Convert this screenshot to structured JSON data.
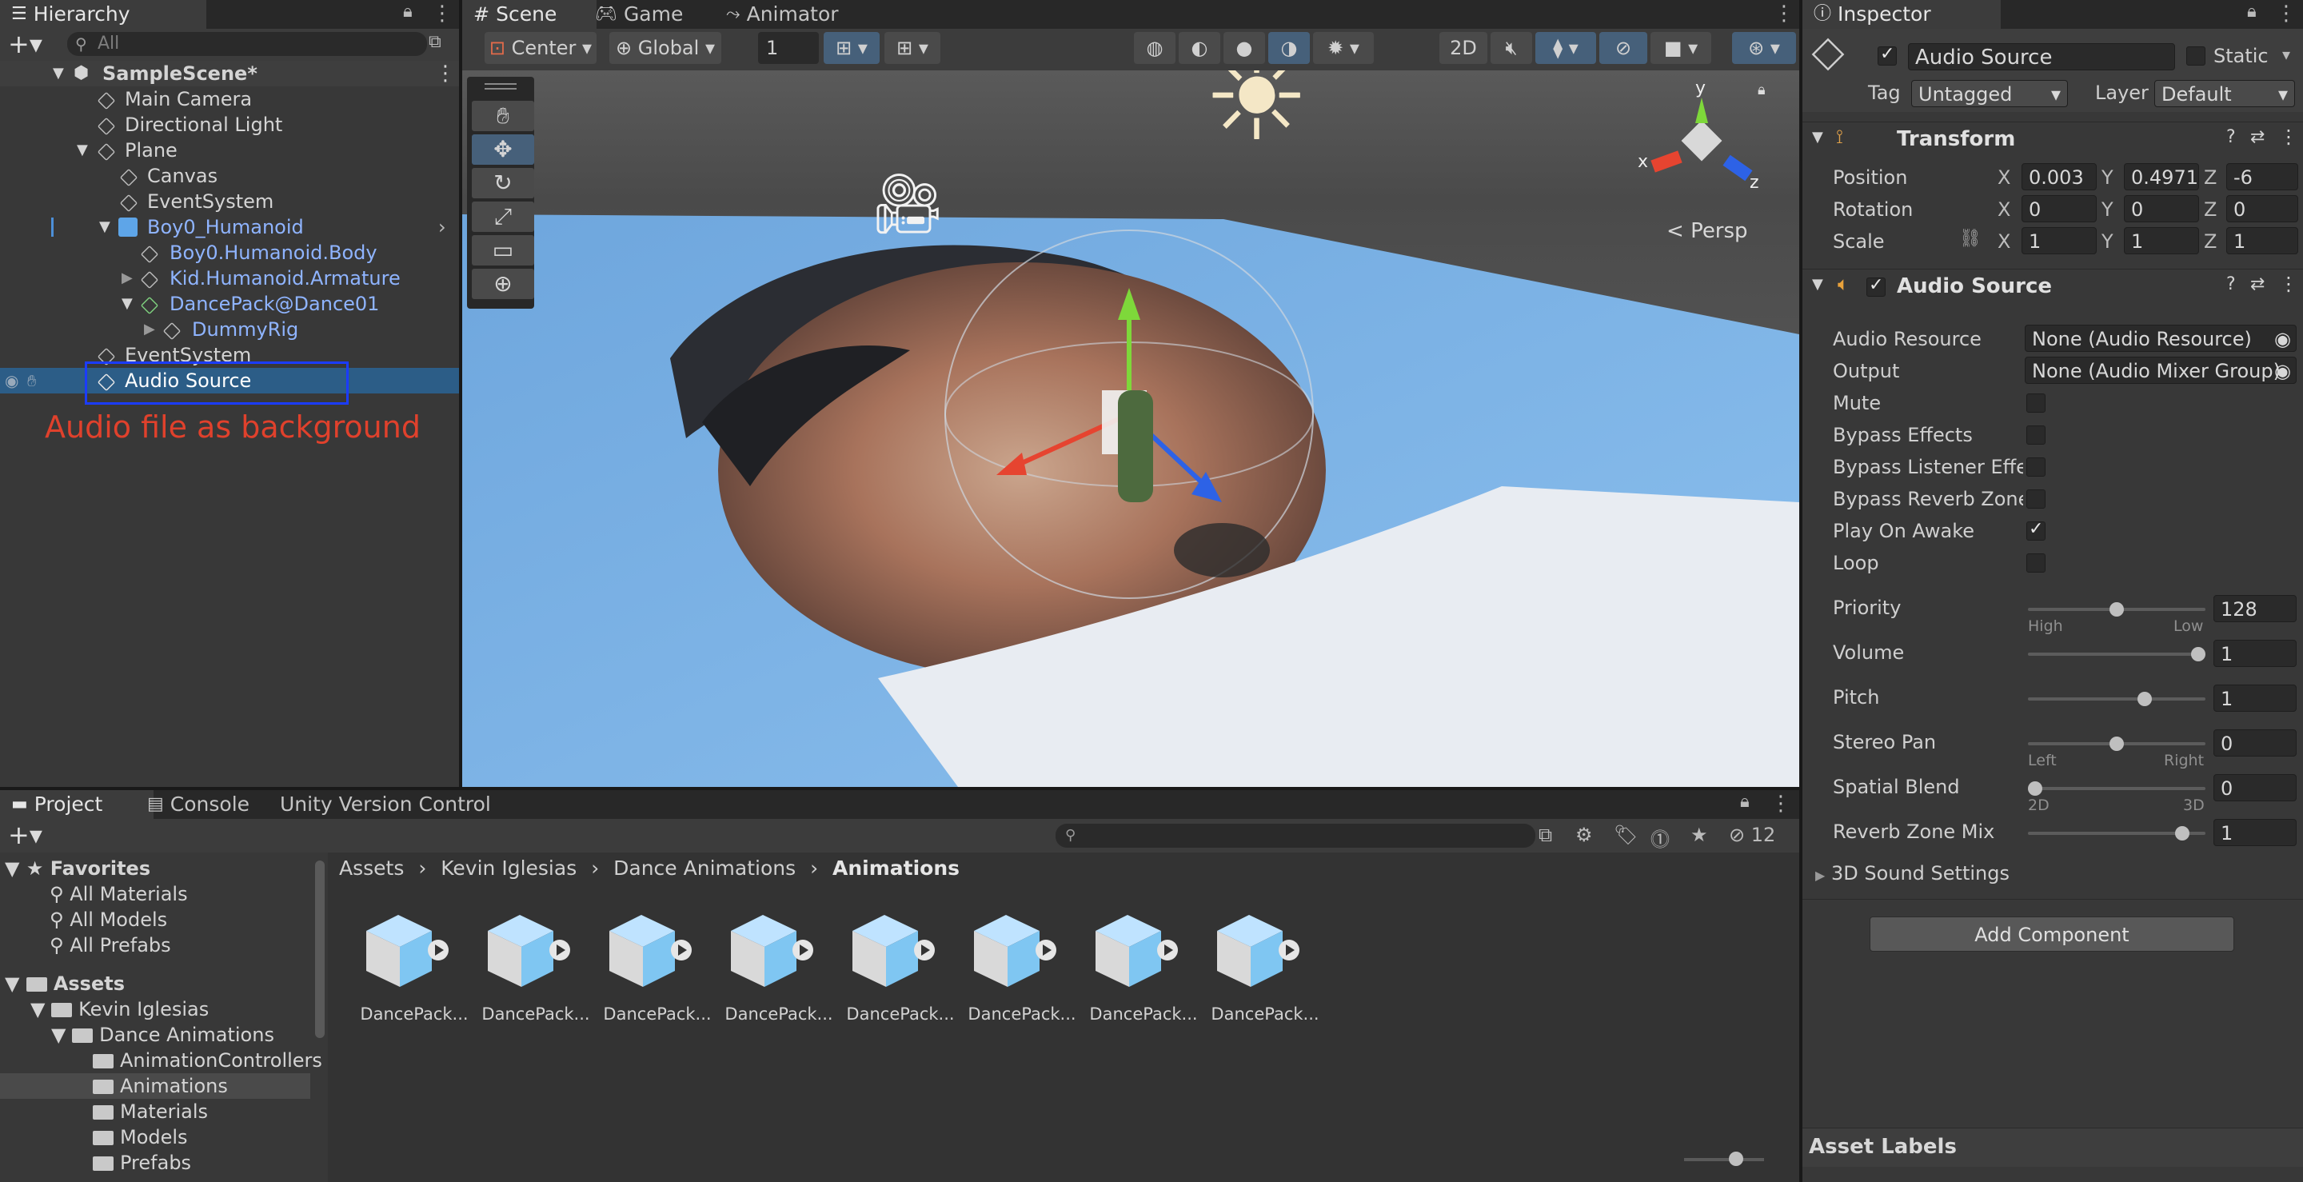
{
  "hierarchy": {
    "tab": "Hierarchy",
    "search_placeholder": "All",
    "scene": "SampleScene*",
    "items": [
      {
        "label": "Main Camera"
      },
      {
        "label": "Directional Light"
      },
      {
        "label": "Plane"
      },
      {
        "label": "Canvas"
      },
      {
        "label": "EventSystem"
      },
      {
        "label": "Boy0_Humanoid"
      },
      {
        "label": "Boy0.Humanoid.Body"
      },
      {
        "label": "Kid.Humanoid.Armature"
      },
      {
        "label": "DancePack@Dance01"
      },
      {
        "label": "DummyRig"
      },
      {
        "label": "EventSystem"
      },
      {
        "label": "Audio Source"
      }
    ],
    "annotation": "Audio file as background"
  },
  "scene_view": {
    "tabs": [
      "Scene",
      "Game",
      "Animator"
    ],
    "pivot": "Center",
    "space": "Global",
    "grid_value": "1",
    "mode_2d": "2D",
    "persp": "Persp",
    "axes": {
      "x": "x",
      "y": "y",
      "z": "z"
    }
  },
  "inspector": {
    "tab": "Inspector",
    "object_name": "Audio Source",
    "static_label": "Static",
    "tag_label": "Tag",
    "tag_value": "Untagged",
    "layer_label": "Layer",
    "layer_value": "Default",
    "transform": {
      "title": "Transform",
      "position_label": "Position",
      "rotation_label": "Rotation",
      "scale_label": "Scale",
      "position": {
        "x": "0.003",
        "y": "0.4971",
        "z": "-6"
      },
      "rotation": {
        "x": "0",
        "y": "0",
        "z": "0"
      },
      "scale": {
        "x": "1",
        "y": "1",
        "z": "1"
      }
    },
    "audio_source": {
      "title": "Audio Source",
      "audio_resource_label": "Audio Resource",
      "audio_resource_value": "None (Audio Resource)",
      "output_label": "Output",
      "output_value": "None (Audio Mixer Group)",
      "mute_label": "Mute",
      "bypass_effects_label": "Bypass Effects",
      "bypass_listener_label": "Bypass Listener Effec",
      "bypass_reverb_label": "Bypass Reverb Zones",
      "play_on_awake_label": "Play On Awake",
      "loop_label": "Loop",
      "priority_label": "Priority",
      "priority_value": "128",
      "priority_fraction": 0.5,
      "priority_high": "High",
      "priority_low": "Low",
      "volume_label": "Volume",
      "volume_value": "1",
      "volume_fraction": 1.0,
      "pitch_label": "Pitch",
      "pitch_value": "1",
      "pitch_fraction": 0.67,
      "stereo_pan_label": "Stereo Pan",
      "stereo_pan_value": "0",
      "stereo_pan_fraction": 0.5,
      "pan_left": "Left",
      "pan_right": "Right",
      "spatial_blend_label": "Spatial Blend",
      "spatial_blend_value": "0",
      "spatial_blend_fraction": 0.0,
      "blend_2d": "2D",
      "blend_3d": "3D",
      "reverb_mix_label": "Reverb Zone Mix",
      "reverb_mix_value": "1",
      "reverb_mix_fraction": 0.9,
      "sound_settings_label": "3D Sound Settings"
    },
    "add_component": "Add Component",
    "asset_labels": "Asset Labels"
  },
  "project": {
    "tabs": [
      "Project",
      "Console",
      "Unity Version Control"
    ],
    "hidden_count": "12",
    "favorites_label": "Favorites",
    "favorites": [
      "All Materials",
      "All Models",
      "All Prefabs"
    ],
    "assets_label": "Assets",
    "tree": [
      "Kevin Iglesias",
      "Dance Animations",
      "AnimationControllers",
      "Animations",
      "Materials",
      "Models",
      "Prefabs"
    ],
    "breadcrumb": [
      "Assets",
      "Kevin Iglesias",
      "Dance Animations",
      "Animations"
    ],
    "assets": [
      "DancePack...",
      "DancePack...",
      "DancePack...",
      "DancePack...",
      "DancePack...",
      "DancePack...",
      "DancePack...",
      "DancePack..."
    ]
  },
  "colors": {
    "accent_blue": "#2c5d87",
    "annotation_red": "#e0412c",
    "highlight_box": "#1b3cff",
    "prefab_blue": "#8fb4ff"
  }
}
